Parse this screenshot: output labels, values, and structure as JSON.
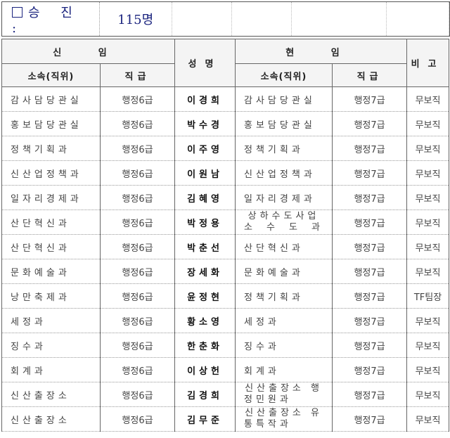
{
  "header": {
    "label": "승 진 :",
    "count": "115명"
  },
  "table": {
    "group_new": "신 임",
    "group_current": "현 임",
    "col_dept": "소속(직위)",
    "col_rank": "직급",
    "col_name": "성명",
    "col_note": "비고",
    "rows": [
      {
        "new_dept": "감사담당관실",
        "new_rank": "행정6급",
        "name": "이경희",
        "cur_dept": "감사담당관실",
        "cur_rank": "행정7급",
        "note": "무보직"
      },
      {
        "new_dept": "홍보담당관실",
        "new_rank": "행정6급",
        "name": "박수경",
        "cur_dept": "홍보담당관실",
        "cur_rank": "행정7급",
        "note": "무보직"
      },
      {
        "new_dept": "정책기획과",
        "new_rank": "행정6급",
        "name": "이주영",
        "cur_dept": "정책기획과",
        "cur_rank": "행정7급",
        "note": "무보직"
      },
      {
        "new_dept": "신산업정책과",
        "new_rank": "행정6급",
        "name": "이원남",
        "cur_dept": "신산업정책과",
        "cur_rank": "행정7급",
        "note": "무보직"
      },
      {
        "new_dept": "일자리경제과",
        "new_rank": "행정6급",
        "name": "김혜영",
        "cur_dept": "일자리경제과",
        "cur_rank": "행정7급",
        "note": "무보직"
      },
      {
        "new_dept": "산단혁신과",
        "new_rank": "행정6급",
        "name": "박정용",
        "cur_dept": "상하수도사업소 수 도 과",
        "cur_rank": "행정7급",
        "note": "무보직"
      },
      {
        "new_dept": "산단혁신과",
        "new_rank": "행정6급",
        "name": "박춘선",
        "cur_dept": "산단혁신과",
        "cur_rank": "행정7급",
        "note": "무보직"
      },
      {
        "new_dept": "문화예술과",
        "new_rank": "행정6급",
        "name": "장세화",
        "cur_dept": "문화예술과",
        "cur_rank": "행정7급",
        "note": "무보직"
      },
      {
        "new_dept": "낭만축제과",
        "new_rank": "행정6급",
        "name": "윤정현",
        "cur_dept": "정책기획과",
        "cur_rank": "행정7급",
        "note": "TF팀장"
      },
      {
        "new_dept": "세정과",
        "new_rank": "행정6급",
        "name": "황소영",
        "cur_dept": "세정과",
        "cur_rank": "행정7급",
        "note": "무보직"
      },
      {
        "new_dept": "징수과",
        "new_rank": "행정6급",
        "name": "한춘화",
        "cur_dept": "징수과",
        "cur_rank": "행정7급",
        "note": "무보직"
      },
      {
        "new_dept": "회계과",
        "new_rank": "행정6급",
        "name": "이상헌",
        "cur_dept": "회계과",
        "cur_rank": "행정7급",
        "note": "무보직"
      },
      {
        "new_dept": "신산출장소",
        "new_rank": "행정6급",
        "name": "김경희",
        "cur_dept": "신산출장소 행정민원과",
        "cur_rank": "행정7급",
        "note": "무보직"
      },
      {
        "new_dept": "신산출장소",
        "new_rank": "행정6급",
        "name": "김무준",
        "cur_dept": "신산출장소 유통특작과",
        "cur_rank": "행정7급",
        "note": "무보직"
      }
    ]
  }
}
